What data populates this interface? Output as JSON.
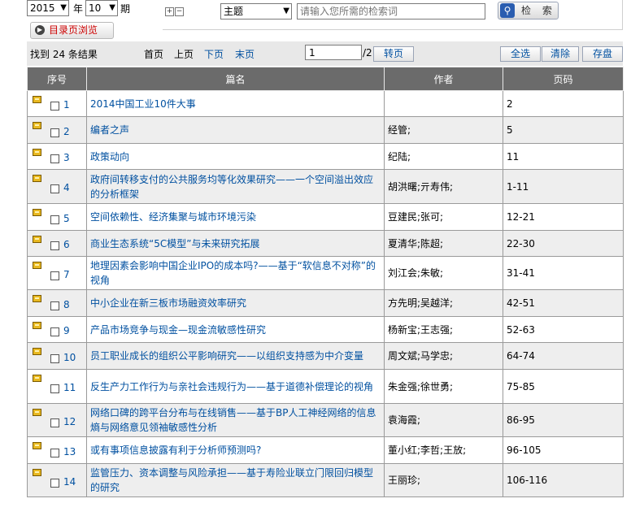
{
  "filter": {
    "year": "2015",
    "year_label": "年",
    "issue": "10",
    "issue_label": "期",
    "tree_expand": "⊞",
    "tree_collapse": "⊟",
    "field": "主题",
    "search_placeholder": "请输入您所需的检索词",
    "search_label": "检 索",
    "toc_label": "目录页浏览"
  },
  "pager": {
    "result_text": "找到 24 条结果",
    "first": "首页",
    "prev": "上页",
    "next": "下页",
    "last": "末页",
    "current_page": "1",
    "total_pages": "/2",
    "goto": "转页",
    "select_all": "全选",
    "clear": "清除",
    "save": "存盘"
  },
  "table": {
    "headers": [
      "序号",
      "篇名",
      "作者",
      "页码"
    ],
    "rows": [
      {
        "no": "1",
        "title": "2014中国工业10件大事",
        "author": "",
        "pages": "2"
      },
      {
        "no": "2",
        "title": "编者之声",
        "author": "经管;",
        "pages": "5"
      },
      {
        "no": "3",
        "title": "政策动向",
        "author": "纪陆;",
        "pages": "11"
      },
      {
        "no": "4",
        "title": "政府间转移支付的公共服务均等化效果研究——一个空间溢出效应的分析框架",
        "author": "胡洪曙;亓寿伟;",
        "pages": "1-11"
      },
      {
        "no": "5",
        "title": "空间依赖性、经济集聚与城市环境污染",
        "author": "豆建民;张可;",
        "pages": "12-21"
      },
      {
        "no": "6",
        "title": "商业生态系统“5C模型”与未来研究拓展",
        "author": "夏清华;陈超;",
        "pages": "22-30"
      },
      {
        "no": "7",
        "title": "地理因素会影响中国企业IPO的成本吗?——基于“软信息不对称”的视角",
        "author": "刘江会;朱敏;",
        "pages": "31-41"
      },
      {
        "no": "8",
        "title": "中小企业在新三板市场融资效率研究",
        "author": "方先明;吴越洋;",
        "pages": "42-51"
      },
      {
        "no": "9",
        "title": "产品市场竞争与现金—现金流敏感性研究",
        "author": "杨新宝;王志强;",
        "pages": "52-63"
      },
      {
        "no": "10",
        "title": "员工职业成长的组织公平影响研究——以组织支持感为中介变量",
        "author": "周文斌;马学忠;",
        "pages": "64-74"
      },
      {
        "no": "11",
        "title": "反生产力工作行为与亲社会违规行为——基于道德补偿理论的视角",
        "author": "朱金强;徐世勇;",
        "pages": "75-85"
      },
      {
        "no": "12",
        "title": "网络口碑的跨平台分布与在线销售——基于BP人工神经网络的信息熵与网络意见领袖敏感性分析",
        "author": "袁海霞;",
        "pages": "86-95"
      },
      {
        "no": "13",
        "title": "或有事项信息披露有利于分析师预测吗?",
        "author": "董小红;李哲;王放;",
        "pages": "96-105"
      },
      {
        "no": "14",
        "title": "监管压力、资本调整与风险承担——基于寿险业联立门限回归模型的研究",
        "author": "王丽珍;",
        "pages": "106-116"
      }
    ]
  }
}
